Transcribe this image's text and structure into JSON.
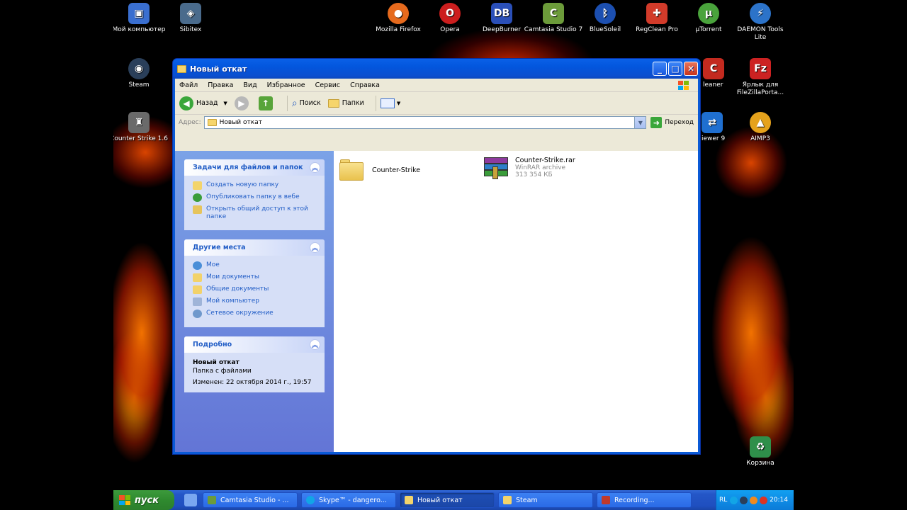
{
  "desktop": {
    "icons": [
      {
        "label": "Мой компьютер",
        "icon": "my-computer-icon",
        "color": "#3a6fd0"
      },
      {
        "label": "Sibitex",
        "icon": "sibitex-icon",
        "color": "#4a6b8c"
      },
      {
        "label": "Mozilla Firefox",
        "icon": "firefox-icon",
        "color": "#e66a1d"
      },
      {
        "label": "Opera",
        "icon": "opera-icon",
        "color": "#cc1e1e"
      },
      {
        "label": "DeepBurner",
        "icon": "deepburner-icon",
        "color": "#2a4fb8"
      },
      {
        "label": "Camtasia Studio 7",
        "icon": "camtasia-icon",
        "color": "#6c9b3a"
      },
      {
        "label": "BlueSoleil",
        "icon": "bluetooth-icon",
        "color": "#1c4fb0"
      },
      {
        "label": "RegClean Pro",
        "icon": "regclean-icon",
        "color": "#d23b2a"
      },
      {
        "label": "µTorrent",
        "icon": "utorrent-icon",
        "color": "#4aa33c"
      },
      {
        "label": "DAEMON Tools Lite",
        "icon": "daemon-tools-icon",
        "color": "#2c73c9"
      },
      {
        "label": "Steam",
        "icon": "steam-icon",
        "color": "#2a3f5a"
      },
      {
        "label": "Counter Strike 1.6",
        "icon": "counter-strike-icon",
        "color": "#6a6a6a"
      },
      {
        "label": "Ярлык для FileZillaPorta...",
        "icon": "filezilla-icon",
        "color": "#c22"
      },
      {
        "label": "leaner",
        "icon": "ccleaner-icon",
        "color": "#c32a1f"
      },
      {
        "label": "iewer 9",
        "icon": "teamviewer-icon",
        "color": "#1f6fd0"
      },
      {
        "label": "AIMP3",
        "icon": "aimp-icon",
        "color": "#e5a21c"
      },
      {
        "label": "Корзина",
        "icon": "recycle-bin-icon",
        "color": "#2f8f4a"
      }
    ]
  },
  "window": {
    "title": "Новый откат",
    "menu": [
      "Файл",
      "Правка",
      "Вид",
      "Избранное",
      "Сервис",
      "Справка"
    ],
    "toolbar": {
      "back": "Назад",
      "search": "Поиск",
      "folders": "Папки"
    },
    "address": {
      "label": "Адрес:",
      "value": "Новый откат",
      "go": "Переход"
    },
    "tasks_panel": {
      "title": "Задачи для файлов и папок",
      "items": [
        "Создать новую папку",
        "Опубликовать папку в вебе",
        "Открыть общий доступ к этой папке"
      ]
    },
    "places_panel": {
      "title": "Другие места",
      "items": [
        "Мое",
        "Мои документы",
        "Общие документы",
        "Мой компьютер",
        "Сетевое окружение"
      ]
    },
    "details_panel": {
      "title": "Подробно",
      "name": "Новый откат",
      "type": "Папка с файлами",
      "modified": "Изменен: 22 октября 2014 г., 19:57"
    },
    "files": [
      {
        "name": "Counter-Strike",
        "type": "",
        "size": ""
      },
      {
        "name": "Counter-Strike.rar",
        "type": "WinRAR archive",
        "size": "313 354 КБ"
      }
    ]
  },
  "taskbar": {
    "start": "пуск",
    "buttons": [
      "Camtasia Studio - ...",
      "Skype™ - dangero...",
      "Новый откат",
      "Steam",
      "Recording..."
    ],
    "tray": {
      "lang": "RL",
      "time": "20:14"
    }
  }
}
